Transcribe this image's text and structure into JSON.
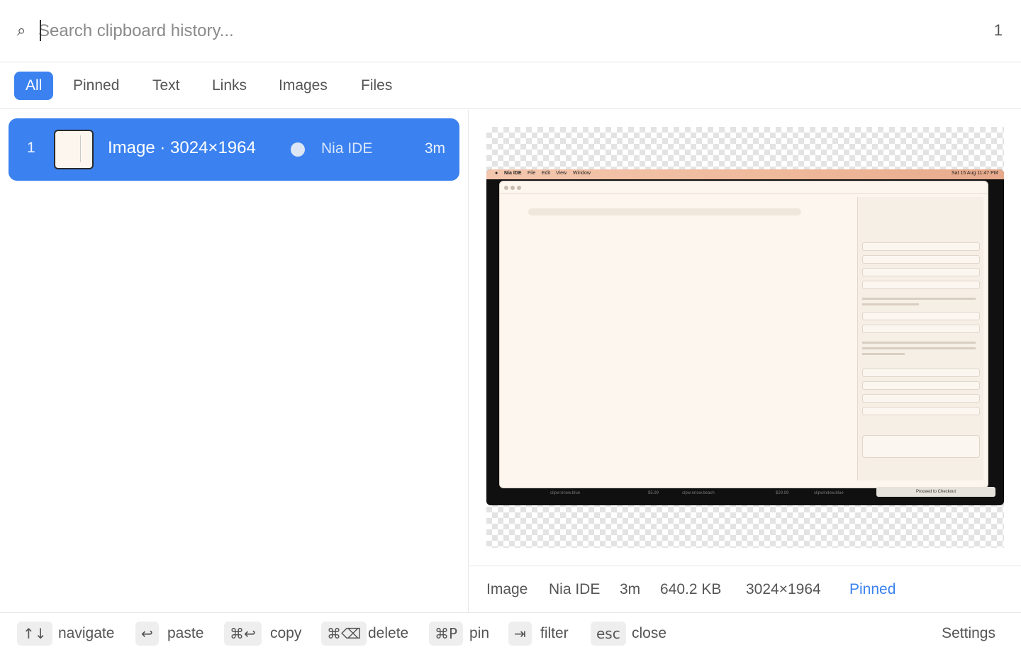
{
  "search": {
    "icon": "search-icon",
    "placeholder": "Search clipboard history...",
    "value": "",
    "result_count": "1"
  },
  "tabs": [
    {
      "label": "All",
      "active": true
    },
    {
      "label": "Pinned",
      "active": false
    },
    {
      "label": "Text",
      "active": false
    },
    {
      "label": "Links",
      "active": false
    },
    {
      "label": "Images",
      "active": false
    },
    {
      "label": "Files",
      "active": false
    }
  ],
  "list": {
    "items": [
      {
        "index": "1",
        "title": "Image · 3024×1964",
        "source": "Nia IDE",
        "age": "3m",
        "selected": true
      }
    ]
  },
  "preview": {
    "menubar": {
      "app": "Nia IDE",
      "menus": [
        "File",
        "Edit",
        "View",
        "Window"
      ],
      "clock": "Sat 15 Aug 11:47 PM"
    },
    "bottom": {
      "item1": "clipw:nnow.blue",
      "price1": "$5.99",
      "item2": "clpw:nnow.beach",
      "price2": "$29.99",
      "item3": "clipwindow.blue",
      "checkout": "Proceed to Checkout"
    }
  },
  "meta": {
    "type": "Image",
    "source": "Nia IDE",
    "age": "3m",
    "size": "640.2 KB",
    "dimensions": "3024×1964",
    "status": "Pinned"
  },
  "footer": {
    "shortcuts": [
      {
        "key": "↑↓",
        "label": "navigate"
      },
      {
        "key": "↩",
        "label": "paste"
      },
      {
        "key": "⌘↩",
        "label": "copy"
      },
      {
        "key": "⌘⌫",
        "label": "delete"
      },
      {
        "key": "⌘P",
        "label": "pin"
      },
      {
        "key": "⇥",
        "label": "filter"
      },
      {
        "key": "esc",
        "label": "close"
      }
    ],
    "settings": "Settings"
  },
  "colors": {
    "accent": "#3b82f0",
    "selected_row": "#3b82f0",
    "pinned": "#3b82f0"
  }
}
